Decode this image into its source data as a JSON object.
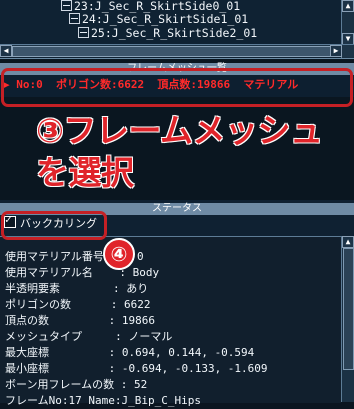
{
  "tree": {
    "items": [
      "23:J_Sec_R_SkirtSide0_01",
      "24:J_Sec_R_SkirtSide1_01",
      "25:J_Sec_R_SkirtSide2_01"
    ]
  },
  "frame_mesh_panel": {
    "title": "フレームメッシュ一覧",
    "row_marker": "▶",
    "row_no": "No:0",
    "row_polygon": "ポリゴン数:6622",
    "row_vertex": "頂点数:19866",
    "row_material": "マテリアル"
  },
  "annotations": {
    "step3_circle": "③",
    "step3_line1": "フレームメッシュ",
    "step3_line2": "を選択",
    "step4_circle": "④"
  },
  "status_panel": {
    "title": "ステータス",
    "backculling_label": "バックカリング",
    "lines": [
      "使用マテリアル番号   : 0",
      "使用マテリアル名    : Body",
      "半透明要素        : あり",
      "ポリゴンの数      : 6622",
      "頂点の数         : 19866",
      "メッシュタイプ     : ノーマル",
      "最大座標         : 0.694, 0.144, -0.594",
      "最小座標         : -0.694, -0.133, -1.609",
      "ボーン用フレームの数 : 52",
      "フレームNo:17 Name:J_Bip_C_Hips"
    ]
  },
  "colors": {
    "accent_red": "#e0242a",
    "frame_row_text": "#ff2a2a",
    "titlebar": "#6f8ba5"
  }
}
